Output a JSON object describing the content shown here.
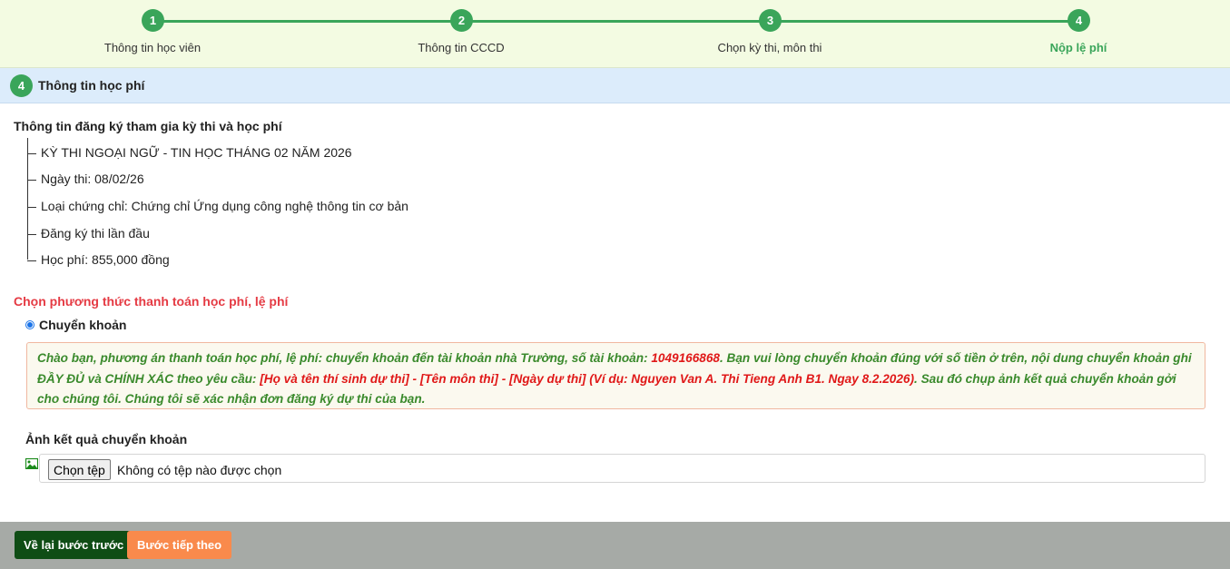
{
  "stepper": {
    "steps": [
      {
        "number": "1",
        "label": "Thông tin học viên"
      },
      {
        "number": "2",
        "label": "Thông tin CCCD"
      },
      {
        "number": "3",
        "label": "Chọn kỳ thi, môn thi"
      },
      {
        "number": "4",
        "label": "Nộp lệ phí"
      }
    ],
    "active_color": "#3aa55a"
  },
  "section": {
    "number": "4",
    "title": "Thông tin học phí"
  },
  "exam_info": {
    "title": "Thông tin đăng ký tham gia kỳ thi và học phí",
    "items": [
      "KỲ THI NGOẠI NGỮ - TIN HỌC THÁNG 02 NĂM 2026",
      "Ngày thi: 08/02/26",
      "Loại chứng chỉ: Chứng chỉ Ứng dụng công nghệ thông tin cơ bản",
      "Đăng ký thi lần đầu",
      "Học phí: 855,000 đồng"
    ]
  },
  "payment": {
    "title": "Chọn phương thức thanh toán học phí, lệ phí",
    "method_label": "Chuyển khoản",
    "method_selected": true,
    "notice": {
      "part1": "Chào bạn, phương án thanh toán học phí, lệ phí: chuyển khoản đến tài khoản nhà Trường, số tài khoản: ",
      "account": "1049166868",
      "part2": ". Bạn vui lòng chuyển khoản đúng với số tiền ở trên, nội dung chuyển khoản ghi ĐẦY ĐỦ và CHÍNH XÁC theo yêu cầu: ",
      "format": "[Họ và tên thí sinh dự thi] - [Tên môn thi] - [Ngày dự thi] (Ví dụ: Nguyen Van A. Thi Tieng Anh B1. Ngay 8.2.2026)",
      "part3": ". Sau đó chụp ảnh kết quả chuyển khoản gởi cho chúng tôi. Chúng tôi sẽ xác nhận đơn đăng ký dự thi của bạn."
    }
  },
  "upload": {
    "label": "Ảnh kết quả chuyển khoản",
    "button_label": "Chọn tệp",
    "status": "Không có tệp nào được chọn",
    "icon": "image-icon"
  },
  "footer": {
    "back_label": "Về lại bước trước",
    "next_label": "Bước tiếp theo",
    "back_color": "#0f4d15",
    "next_color": "#f98a4c"
  }
}
